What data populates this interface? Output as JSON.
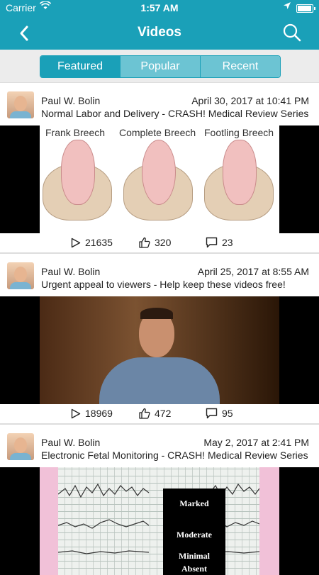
{
  "status_bar": {
    "carrier": "Carrier",
    "time": "1:57 AM"
  },
  "nav": {
    "title": "Videos"
  },
  "segments": [
    "Featured",
    "Popular",
    "Recent"
  ],
  "selected_segment": "Featured",
  "posts": [
    {
      "author": "Paul W. Bolin",
      "date": "April 30, 2017 at 10:41 PM",
      "title": "Normal Labor and Delivery - CRASH! Medical Review Series",
      "thumbnail_labels": [
        "Frank Breech",
        "Complete Breech",
        "Footling Breech"
      ],
      "views": "21635",
      "likes": "320",
      "comments": "23"
    },
    {
      "author": "Paul W. Bolin",
      "date": "April 25, 2017 at 8:55 AM",
      "title": "Urgent appeal to viewers - Help keep these videos free!",
      "views": "18969",
      "likes": "472",
      "comments": "95"
    },
    {
      "author": "Paul W. Bolin",
      "date": "May 2, 2017 at 2:41 PM",
      "title": "Electronic Fetal Monitoring - CRASH! Medical Review Series",
      "thumbnail_labels": [
        "Marked",
        "Moderate",
        "Minimal",
        "Absent"
      ]
    }
  ],
  "colors": {
    "accent": "#1aa0b8",
    "segment_inactive": "#6cc4d3"
  }
}
